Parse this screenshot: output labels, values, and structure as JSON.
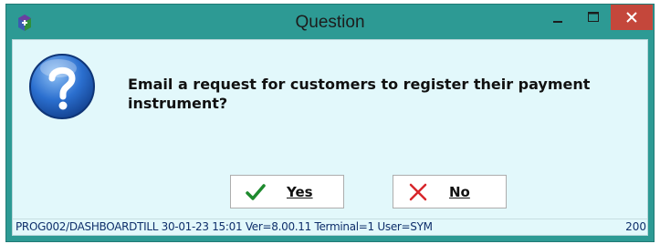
{
  "window": {
    "title": "Question",
    "controls": {
      "minimize": "minimize",
      "maximize": "maximize",
      "close": "close"
    }
  },
  "dialog": {
    "icon": "question-icon",
    "message": "Email a request for customers to register their payment instrument?",
    "buttons": [
      {
        "label": "Yes",
        "icon": "check-icon",
        "color": "#1e8a2e"
      },
      {
        "label": "No",
        "icon": "cross-icon",
        "color": "#d7262b"
      }
    ]
  },
  "status": {
    "left": "PROG002/DASHBOARDTILL  30-01-23 15:01  Ver=8.00.11 Terminal=1 User=SYM",
    "right": "200"
  },
  "colors": {
    "titlebar": "#2d9a94",
    "client": "#e2f8fb",
    "close_button": "#c4473b",
    "status_text": "#0f2f6b"
  }
}
